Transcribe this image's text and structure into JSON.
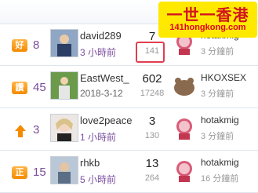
{
  "rows": [
    {
      "badge": "好",
      "badge_color": "#f48a00",
      "count": "8",
      "avatar": "user-photo-1",
      "name": "david289",
      "time": "3 小時前",
      "replies": "7",
      "views": "141",
      "last_name": "hotakmig",
      "last_time": "3 分鐘前"
    },
    {
      "badge": "讚",
      "badge_color": "#f48a00",
      "count": "45",
      "avatar": "user-photo-2",
      "name": "EastWest_",
      "time": "2018-3-12",
      "replies": "602",
      "views": "17248",
      "last_name": "HKOXSEX",
      "last_time": "3 分鐘前"
    },
    {
      "badge": "↑",
      "badge_color": "#f48a00",
      "count": "3",
      "avatar": "user-photo-3",
      "name": "love2peace",
      "time": "1 小時前",
      "replies": "3",
      "views": "130",
      "last_name": "hotakmig",
      "last_time": "3 分鐘前"
    },
    {
      "badge": "正",
      "badge_color": "#f48a00",
      "count": "15",
      "avatar": "user-photo-4",
      "name": "rhkb",
      "time": "5 小時前",
      "replies": "13",
      "views": "264",
      "last_name": "hotakmig",
      "last_time": "16 分鐘前"
    }
  ],
  "watermark": {
    "title": "一世一香港",
    "url": "141hongkong.com"
  },
  "colors": {
    "highlight": "#e23d4f",
    "purple_text": "#7a4e9e",
    "logo_bg": "#ffe900",
    "logo_text": "#d2141f"
  }
}
